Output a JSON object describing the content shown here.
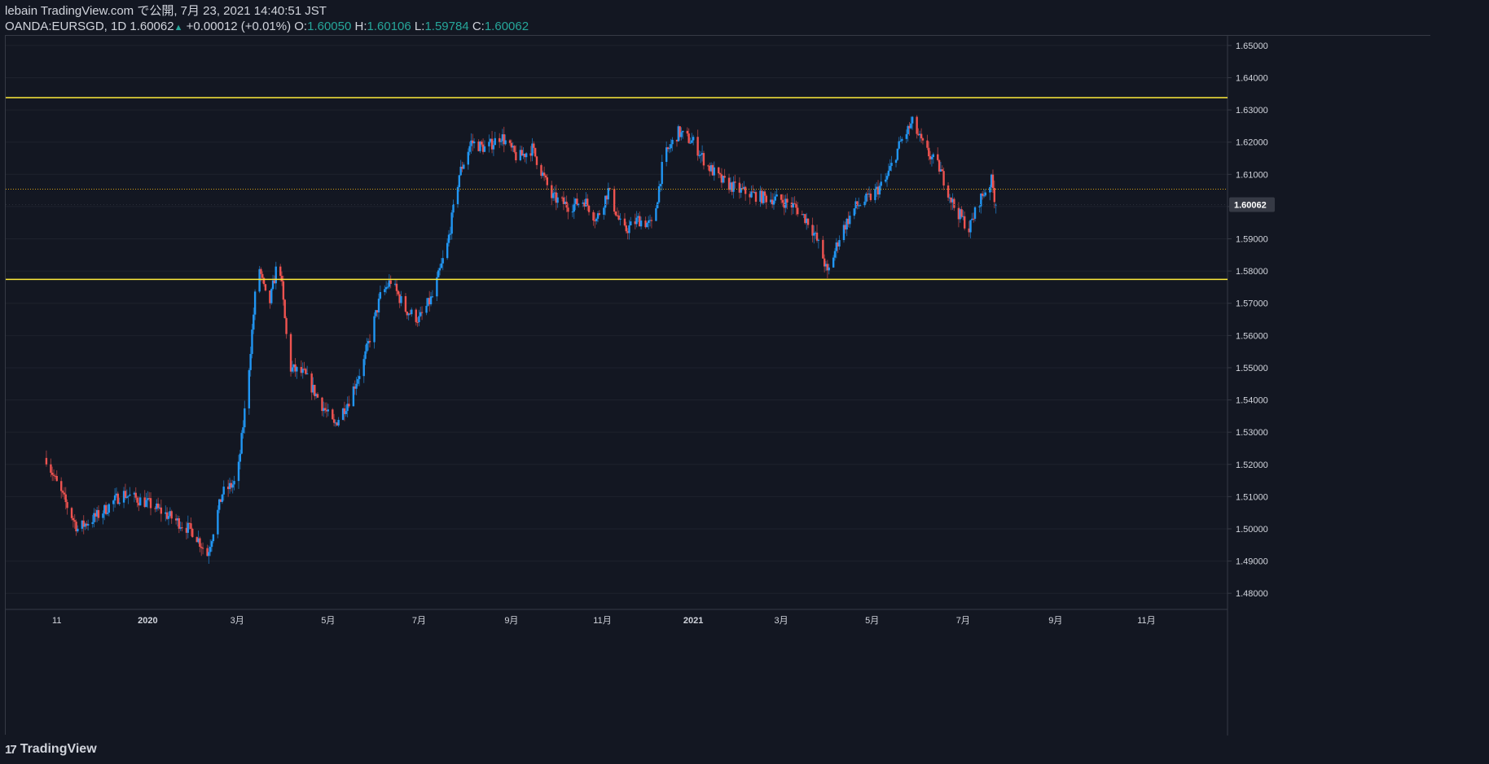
{
  "header": {
    "line1": "lebain TradingView.com で公開, 7月 23, 2021 14:40:51 JST",
    "symbol": "OANDA:EURSGD, 1D 1.60062",
    "change": "+0.00012 (+0.01%)",
    "o_label": "O:",
    "o_value": "1.60050",
    "h_label": "H:",
    "h_value": "1.60106",
    "l_label": "L:",
    "l_value": "1.59784",
    "c_label": "C:",
    "c_value": "1.60062"
  },
  "footer": {
    "logo_text": "TradingView",
    "logo_mark": "17"
  },
  "colors": {
    "background": "#131722",
    "up": "#2196f3",
    "down": "#ef5350",
    "hline": "#ffeb3b",
    "grid": "#1e222d",
    "axis_text": "#d1d4dc",
    "price_tag_bg": "#363a45"
  },
  "chart_data": {
    "type": "candlestick",
    "symbol": "OANDA:EURSGD",
    "interval": "1D",
    "ylim": [
      1.475,
      1.653
    ],
    "y_ticks": [
      "1.65000",
      "1.64000",
      "1.63000",
      "1.62000",
      "1.61000",
      "1.60000",
      "1.59000",
      "1.58000",
      "1.57000",
      "1.56000",
      "1.55000",
      "1.54000",
      "1.53000",
      "1.52000",
      "1.51000",
      "1.50000",
      "1.49000",
      "1.48000"
    ],
    "x_ticks": [
      "11",
      "2020",
      "3月",
      "5月",
      "7月",
      "9月",
      "11月",
      "2021",
      "3月",
      "5月",
      "7月",
      "9月",
      "11月"
    ],
    "last_price_label": "1.60062",
    "last_price": 1.60062,
    "horizontal_lines": [
      {
        "price": 1.6338,
        "color": "#ffeb3b"
      },
      {
        "price": 1.5774,
        "color": "#ffeb3b"
      }
    ],
    "close_series": [
      {
        "date": "2019-10-25",
        "close": 1.522
      },
      {
        "date": "2019-11-01",
        "close": 1.514
      },
      {
        "date": "2019-11-15",
        "close": 1.5
      },
      {
        "date": "2019-12-01",
        "close": 1.505
      },
      {
        "date": "2019-12-15",
        "close": 1.511
      },
      {
        "date": "2020-01-01",
        "close": 1.508
      },
      {
        "date": "2020-01-15",
        "close": 1.504
      },
      {
        "date": "2020-02-01",
        "close": 1.499
      },
      {
        "date": "2020-02-10",
        "close": 1.492
      },
      {
        "date": "2020-02-20",
        "close": 1.511
      },
      {
        "date": "2020-03-01",
        "close": 1.515
      },
      {
        "date": "2020-03-08",
        "close": 1.545
      },
      {
        "date": "2020-03-15",
        "close": 1.583
      },
      {
        "date": "2020-03-22",
        "close": 1.568
      },
      {
        "date": "2020-03-29",
        "close": 1.585
      },
      {
        "date": "2020-04-05",
        "close": 1.55
      },
      {
        "date": "2020-04-15",
        "close": 1.548
      },
      {
        "date": "2020-04-25",
        "close": 1.54
      },
      {
        "date": "2020-05-05",
        "close": 1.532
      },
      {
        "date": "2020-05-15",
        "close": 1.54
      },
      {
        "date": "2020-05-25",
        "close": 1.552
      },
      {
        "date": "2020-06-05",
        "close": 1.572
      },
      {
        "date": "2020-06-12",
        "close": 1.577
      },
      {
        "date": "2020-06-22",
        "close": 1.568
      },
      {
        "date": "2020-07-01",
        "close": 1.565
      },
      {
        "date": "2020-07-10",
        "close": 1.572
      },
      {
        "date": "2020-07-20",
        "close": 1.588
      },
      {
        "date": "2020-07-28",
        "close": 1.61
      },
      {
        "date": "2020-08-05",
        "close": 1.62
      },
      {
        "date": "2020-08-15",
        "close": 1.618
      },
      {
        "date": "2020-08-25",
        "close": 1.622
      },
      {
        "date": "2020-09-05",
        "close": 1.615
      },
      {
        "date": "2020-09-15",
        "close": 1.618
      },
      {
        "date": "2020-09-28",
        "close": 1.603
      },
      {
        "date": "2020-10-10",
        "close": 1.6
      },
      {
        "date": "2020-10-20",
        "close": 1.602
      },
      {
        "date": "2020-10-28",
        "close": 1.596
      },
      {
        "date": "2020-11-05",
        "close": 1.605
      },
      {
        "date": "2020-11-15",
        "close": 1.592
      },
      {
        "date": "2020-11-25",
        "close": 1.596
      },
      {
        "date": "2020-12-05",
        "close": 1.594
      },
      {
        "date": "2020-12-12",
        "close": 1.615
      },
      {
        "date": "2020-12-22",
        "close": 1.623
      },
      {
        "date": "2021-01-01",
        "close": 1.62
      },
      {
        "date": "2021-01-10",
        "close": 1.613
      },
      {
        "date": "2021-01-20",
        "close": 1.608
      },
      {
        "date": "2021-02-01",
        "close": 1.605
      },
      {
        "date": "2021-02-15",
        "close": 1.603
      },
      {
        "date": "2021-03-01",
        "close": 1.602
      },
      {
        "date": "2021-03-10",
        "close": 1.6
      },
      {
        "date": "2021-03-20",
        "close": 1.595
      },
      {
        "date": "2021-03-28",
        "close": 1.586
      },
      {
        "date": "2021-04-01",
        "close": 1.579
      },
      {
        "date": "2021-04-10",
        "close": 1.592
      },
      {
        "date": "2021-04-20",
        "close": 1.6
      },
      {
        "date": "2021-04-30",
        "close": 1.603
      },
      {
        "date": "2021-05-10",
        "close": 1.608
      },
      {
        "date": "2021-05-20",
        "close": 1.62
      },
      {
        "date": "2021-05-28",
        "close": 1.626
      },
      {
        "date": "2021-06-05",
        "close": 1.618
      },
      {
        "date": "2021-06-15",
        "close": 1.612
      },
      {
        "date": "2021-06-25",
        "close": 1.6
      },
      {
        "date": "2021-07-05",
        "close": 1.593
      },
      {
        "date": "2021-07-12",
        "close": 1.602
      },
      {
        "date": "2021-07-20",
        "close": 1.608
      },
      {
        "date": "2021-07-23",
        "close": 1.60062
      }
    ]
  }
}
